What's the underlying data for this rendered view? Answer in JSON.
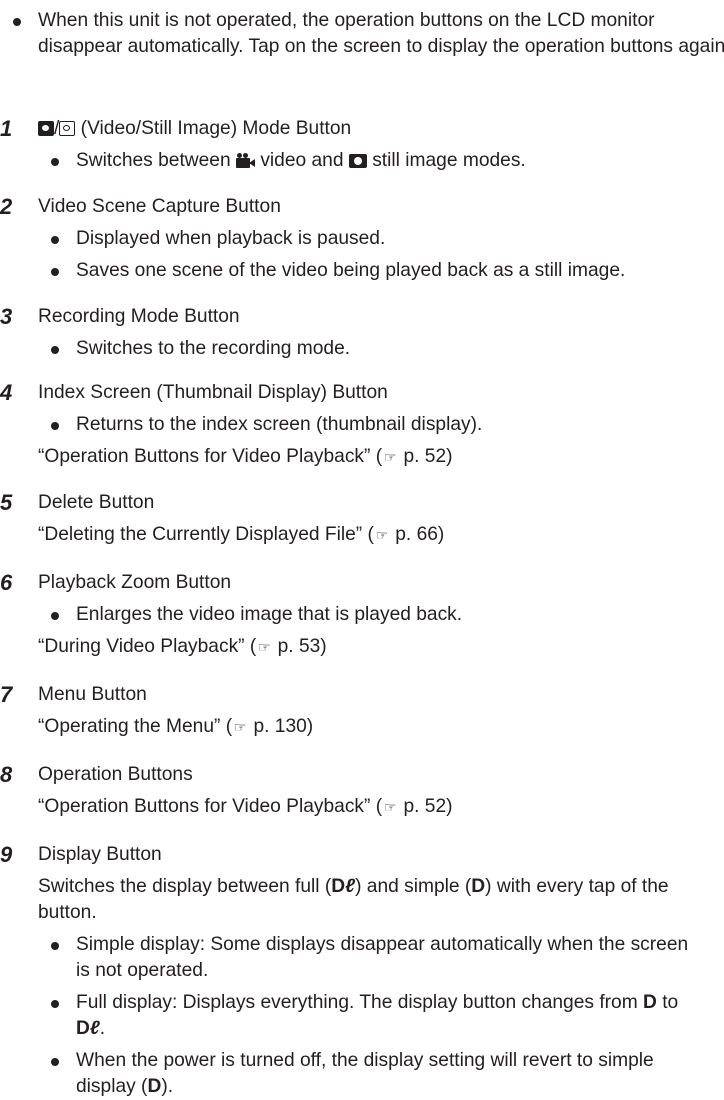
{
  "intro": "When this unit is not operated, the operation buttons on the LCD monitor disappear automatically. Tap on the screen to display the operation buttons again.",
  "items": [
    {
      "number": "1",
      "title": " (Video/Still Image) Mode Button",
      "bullet_prefix": "Switches between ",
      "bullet_mid": " video and ",
      "bullet_suffix": " still image modes."
    },
    {
      "number": "2",
      "title": "Video Scene Capture Button",
      "bullets": [
        "Displayed when playback is paused.",
        "Saves one scene of the video being played back as a still image."
      ]
    },
    {
      "number": "3",
      "title": "Recording Mode Button",
      "bullets": [
        "Switches to the recording mode."
      ]
    },
    {
      "number": "4",
      "title": "Index Screen (Thumbnail Display) Button",
      "bullets": [
        "Returns to the index screen (thumbnail display)."
      ],
      "ref_text": "“Operation Buttons for Video Playback” (",
      "ref_page": " p. 52)"
    },
    {
      "number": "5",
      "title": "Delete Button",
      "ref_text": "“Deleting the Currently Displayed File” (",
      "ref_page": " p. 66)"
    },
    {
      "number": "6",
      "title": "Playback Zoom Button",
      "bullets": [
        "Enlarges the video image that is played back."
      ],
      "ref_text": "“During Video Playback” (",
      "ref_page": " p. 53)"
    },
    {
      "number": "7",
      "title": "Menu Button",
      "ref_text": "“Operating the Menu” (",
      "ref_page": " p. 130)"
    },
    {
      "number": "8",
      "title": "Operation Buttons",
      "ref_text": "“Operation Buttons for Video Playback” (",
      "ref_page": " p. 52)"
    },
    {
      "number": "9",
      "title": "Display Button",
      "desc_a": "Switches the display between full (",
      "desc_full": "D",
      "desc_b": ") and simple (",
      "desc_simple": "D",
      "desc_c": ") with every tap of the button.",
      "b1": "Simple display: Some displays disappear automatically when the screen is not operated.",
      "b2_a": "Full display: Displays everything. The display button changes from ",
      "b2_d": "D",
      "b2_b": " to ",
      "b2_full": "D",
      "b2_c": ".",
      "b3_a": "When the power is turned off, the display setting will revert to simple display (",
      "b3_d": "D",
      "b3_b": ")."
    }
  ],
  "icons": {
    "mode_button": "video-still-mode-icon",
    "video": "video-camera-icon",
    "still": "still-camera-icon",
    "reference": "reference-hand-icon",
    "full_display": "full-display-icon"
  },
  "ref_glyph": "☞"
}
